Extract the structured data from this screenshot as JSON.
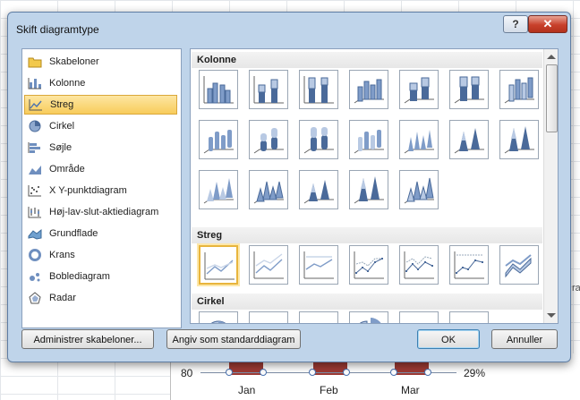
{
  "dialog": {
    "title": "Skift diagramtype",
    "help_label": "?",
    "close_label": "✕"
  },
  "chart_types": [
    {
      "label": "Skabeloner",
      "icon": "folder-icon",
      "selected": false
    },
    {
      "label": "Kolonne",
      "icon": "column-chart-icon",
      "selected": false
    },
    {
      "label": "Streg",
      "icon": "line-chart-icon",
      "selected": true
    },
    {
      "label": "Cirkel",
      "icon": "pie-chart-icon",
      "selected": false
    },
    {
      "label": "Søjle",
      "icon": "bar-chart-icon",
      "selected": false
    },
    {
      "label": "Område",
      "icon": "area-chart-icon",
      "selected": false
    },
    {
      "label": "X Y-punktdiagram",
      "icon": "scatter-chart-icon",
      "selected": false
    },
    {
      "label": "Høj-lav-slut-aktiediagram",
      "icon": "stock-chart-icon",
      "selected": false
    },
    {
      "label": "Grundflade",
      "icon": "surface-chart-icon",
      "selected": false
    },
    {
      "label": "Krans",
      "icon": "doughnut-chart-icon",
      "selected": false
    },
    {
      "label": "Boblediagram",
      "icon": "bubble-chart-icon",
      "selected": false
    },
    {
      "label": "Radar",
      "icon": "radar-chart-icon",
      "selected": false
    }
  ],
  "sections": {
    "kolonne": "Kolonne",
    "streg": "Streg",
    "cirkel": "Cirkel"
  },
  "buttons": {
    "manage_templates": "Administrer skabeloner...",
    "set_default": "Angiv som standarddiagram",
    "ok": "OK",
    "cancel": "Annuller"
  },
  "background": {
    "y_left": "80",
    "y_right": "29%",
    "x_labels": [
      "Jan",
      "Feb",
      "Mar"
    ],
    "peek": "ra"
  },
  "colors": {
    "accent": "#f8cc5b",
    "bar": "#9e3a34",
    "dialog_frame": "#bfd4ea"
  }
}
